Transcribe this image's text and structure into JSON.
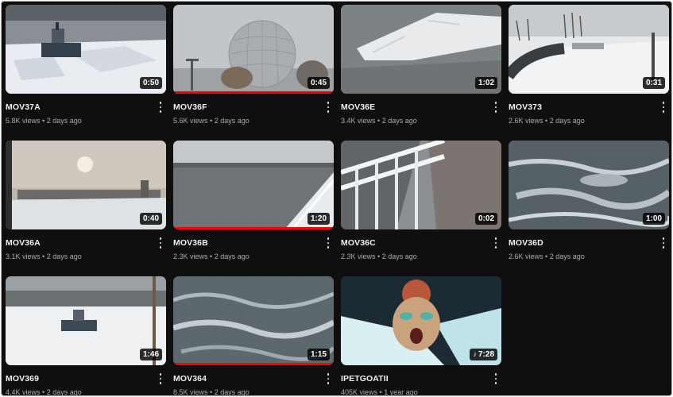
{
  "videos": [
    {
      "title": "MOV37A",
      "views": "5.8K views",
      "age": "2 days ago",
      "duration": "0:50",
      "progress": 0.0
    },
    {
      "title": "MOV36F",
      "views": "5.6K views",
      "age": "2 days ago",
      "duration": "0:45",
      "progress": 1.0
    },
    {
      "title": "MOV36E",
      "views": "3.4K views",
      "age": "2 days ago",
      "duration": "1:02",
      "progress": 0.0
    },
    {
      "title": "MOV373",
      "views": "2.6K views",
      "age": "2 days ago",
      "duration": "0:31",
      "progress": 0.0
    },
    {
      "title": "MOV36A",
      "views": "3.1K views",
      "age": "2 days ago",
      "duration": "0:40",
      "progress": 0.0
    },
    {
      "title": "MOV36B",
      "views": "2.3K views",
      "age": "2 days ago",
      "duration": "1:20",
      "progress": 1.0
    },
    {
      "title": "MOV36C",
      "views": "2.3K views",
      "age": "2 days ago",
      "duration": "0:02",
      "progress": 0.0
    },
    {
      "title": "MOV36D",
      "views": "2.6K views",
      "age": "2 days ago",
      "duration": "1:00",
      "progress": 0.0
    },
    {
      "title": "MOV369",
      "views": "4.4K views",
      "age": "2 days ago",
      "duration": "1:46",
      "progress": 0.0
    },
    {
      "title": "MOV364",
      "views": "8.5K views",
      "age": "2 days ago",
      "duration": "1:15",
      "progress": 1.0
    },
    {
      "title": "IPETGOATII",
      "views": "405K views",
      "age": "1 year ago",
      "duration": "7:28",
      "progress": 0.0,
      "short_icon": "♪"
    }
  ],
  "separator": "•",
  "colors": {
    "background": "#0f0f0f",
    "progress": "#ff0000",
    "title": "#f1f1f1",
    "meta": "#aaaaaa"
  },
  "icons": {
    "more": "vertical-ellipsis-icon"
  }
}
